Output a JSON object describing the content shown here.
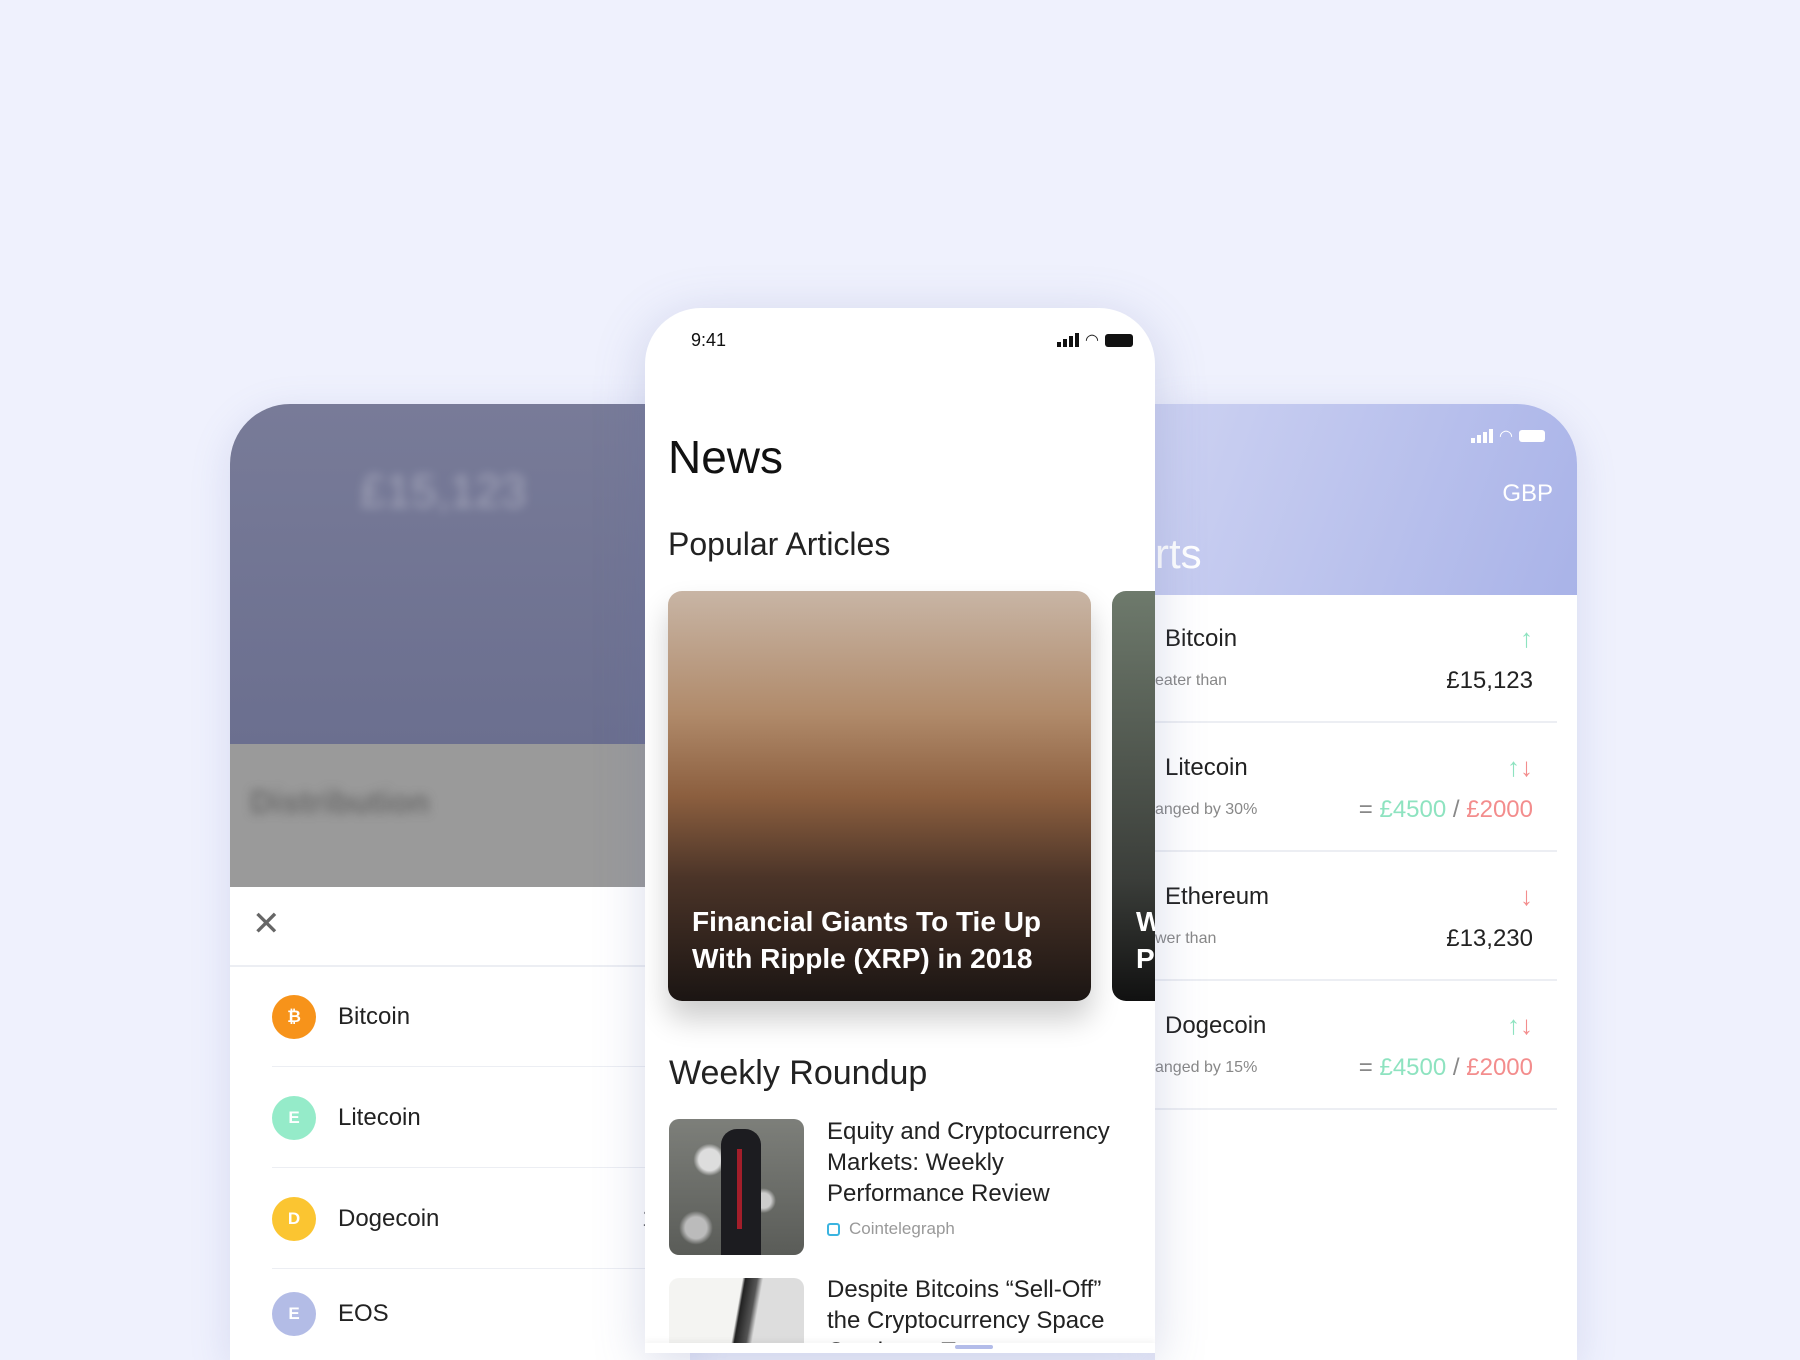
{
  "left_screen": {
    "blurred_balance": "£15,123",
    "blurred_section": "Distribution",
    "coins": [
      {
        "name": "Bitcoin",
        "letter": "₿",
        "color": "#f7931a"
      },
      {
        "name": "Litecoin",
        "letter": "E",
        "color": "#95ebc9"
      },
      {
        "name": "Dogecoin",
        "letter": "D",
        "color": "#fbc531",
        "value_partial": "1"
      },
      {
        "name": "EOS",
        "letter": "E",
        "color": "#b3bce6"
      }
    ]
  },
  "center_screen": {
    "time": "9:41",
    "title": "News",
    "popular_heading": "Popular Articles",
    "featured": [
      {
        "title": "Financial Giants To Tie Up With Ripple (XRP) in 2018"
      },
      {
        "title": "W P"
      }
    ],
    "weekly_heading": "Weekly Roundup",
    "articles": [
      {
        "title": "Equity and Cryptocurrency Markets: Weekly Performance Review",
        "source": "Cointelegraph"
      },
      {
        "title": "Despite Bitcoins “Sell-Off” the Cryptocurrency Space Continues T..."
      }
    ]
  },
  "right_screen": {
    "currency": "GBP",
    "title_partial": "rts",
    "alerts": [
      {
        "name": "Bitcoin",
        "sub": "eater than",
        "value": "£15,123",
        "direction": "up"
      },
      {
        "name": "Litecoin",
        "sub": "anged by 30%",
        "eq": "=",
        "high": "£4500",
        "sep": "/",
        "low": "£2000",
        "direction": "both"
      },
      {
        "name": "Ethereum",
        "sub": "wer than",
        "value": "£13,230",
        "direction": "down"
      },
      {
        "name": "Dogecoin",
        "sub": "anged by 15%",
        "eq": "=",
        "high": "£4500",
        "sep": "/",
        "low": "£2000",
        "direction": "both"
      }
    ],
    "colors": {
      "up": "#8ee3c0",
      "down": "#f38d8d",
      "header": "#b3bce9"
    }
  }
}
